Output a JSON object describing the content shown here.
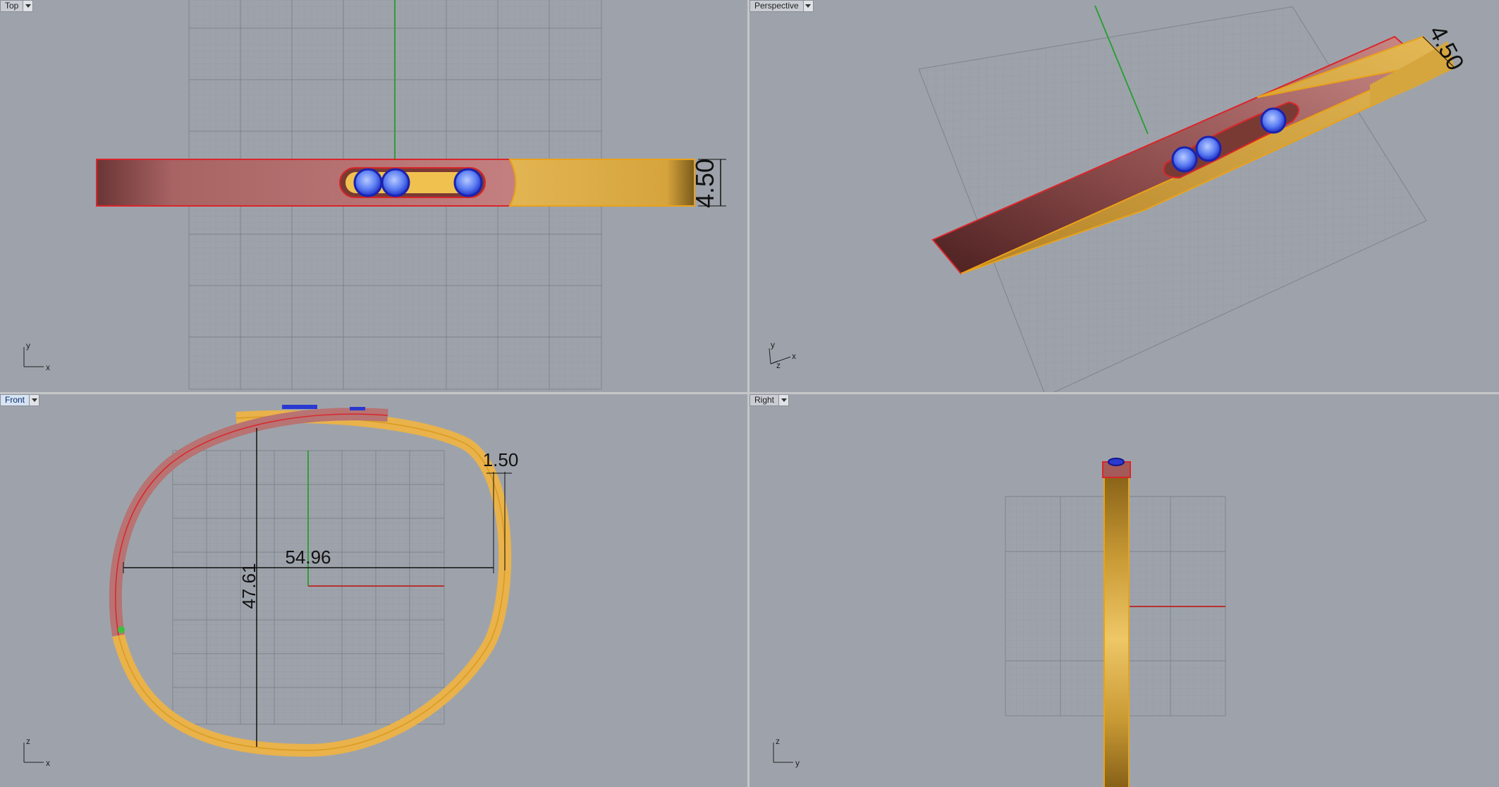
{
  "viewports": {
    "top": {
      "label": "Top",
      "axis_h": "x",
      "axis_v": "y",
      "dimension": "4.50"
    },
    "perspective": {
      "label": "Perspective",
      "axis_h": "x",
      "axis_v": "y",
      "axis_d": "z",
      "dimension": "4.50"
    },
    "front": {
      "label": "Front",
      "axis_h": "x",
      "axis_v": "z",
      "dim_width": "54.96",
      "dim_height": "47.61",
      "dim_thickness": "1.50"
    },
    "right": {
      "label": "Right",
      "axis_h": "y",
      "axis_v": "z"
    }
  },
  "colors": {
    "background": "#9ea3ab",
    "grid": "#8b9098",
    "gold": "#e8b64a",
    "gold_dark": "#b8862a",
    "rose": "#b86b6b",
    "rose_dark": "#6b3030",
    "gem": "#2a4be0",
    "gem_light": "#9db8ff",
    "outline": "#e9a21a",
    "highlight": "#d9262b",
    "axis_y": "#2e9e3a",
    "axis_x": "#b8312f"
  }
}
